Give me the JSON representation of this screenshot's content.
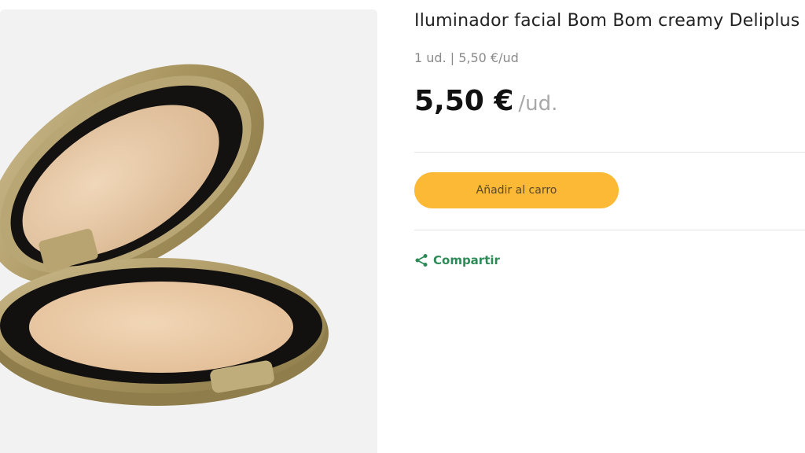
{
  "product": {
    "title": "Iluminador facial Bom Bom creamy Deliplus",
    "unit_info": "1 ud. | 5,50 €/ud",
    "price": "5,50 €",
    "price_unit": "/ud.",
    "image_icon": "compact-highlighter-image"
  },
  "actions": {
    "add_to_cart_label": "Añadir al carro",
    "share_label": "Compartir",
    "share_icon": "share-icon"
  },
  "colors": {
    "accent_button": "#fbb935",
    "share_green": "#2e8b57",
    "image_bg": "#f2f2f2"
  }
}
